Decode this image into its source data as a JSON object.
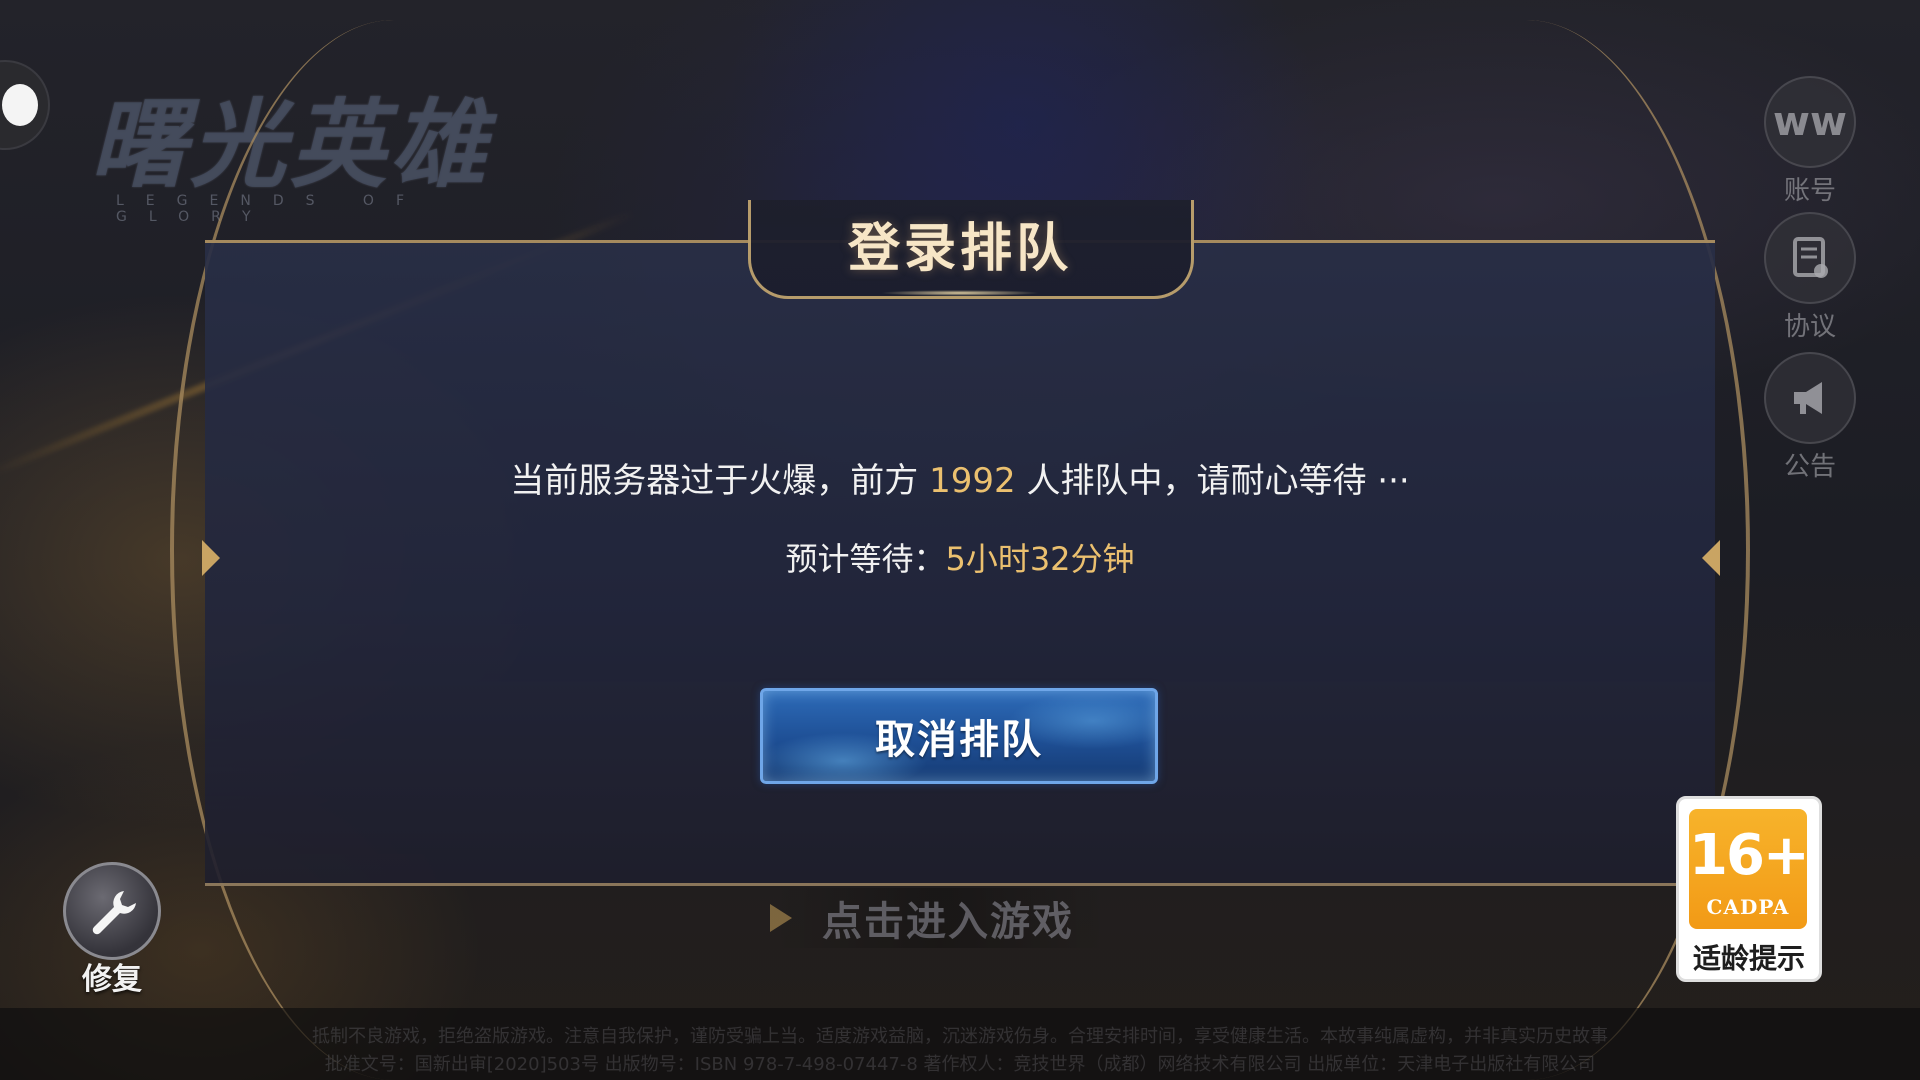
{
  "app": {
    "logo_title": "曙光英雄",
    "logo_subtitle": "LEGENDS OF GLORY"
  },
  "dialog": {
    "title": "登录排队",
    "queue_prefix": "当前服务器过于火爆，前方 ",
    "queue_count": "1992",
    "queue_suffix": " 人排队中，请耐心等待 ···",
    "wait_label": "预计等待：",
    "wait_value": "5小时32分钟",
    "cancel_label": "取消排队"
  },
  "enter_game": {
    "label": "点击进入游戏"
  },
  "side_buttons": [
    {
      "label": "账号",
      "icon": "account-icon"
    },
    {
      "label": "协议",
      "icon": "agreement-icon"
    },
    {
      "label": "公告",
      "icon": "announcement-icon"
    }
  ],
  "repair": {
    "label": "修复",
    "icon": "wrench-icon"
  },
  "age_rating": {
    "age": "16+",
    "org": "CADPA",
    "label": "适龄提示"
  },
  "footer": {
    "line1": "抵制不良游戏，拒绝盗版游戏。注意自我保护，谨防受骗上当。适度游戏益脑，沉迷游戏伤身。合理安排时间，享受健康生活。本故事纯属虚构，并非真实历史故事",
    "line2": "批准文号：国新出审[2020]503号 出版物号：ISBN 978-7-498-07447-8 著作权人：竞技世界（成都）网络技术有限公司 出版单位：天津电子出版社有限公司"
  },
  "colors": {
    "accent_gold": "#ebc06f",
    "button_blue": "#1e4f95",
    "frame_gold": "#c9a463",
    "badge_orange": "#f29a16"
  }
}
